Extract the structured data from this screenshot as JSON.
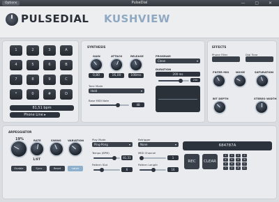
{
  "window": {
    "title": "PulseDial",
    "options_label": "Options",
    "controls": "—  ▢  ✕"
  },
  "brand": {
    "name": "PULSEDIAL",
    "vendor": "KUSHVIEW"
  },
  "keypad": {
    "keys": [
      "1",
      "2",
      "3",
      "A",
      "4",
      "5",
      "6",
      "B",
      "7",
      "8",
      "9",
      "C",
      "*",
      "0",
      "#",
      "D"
    ],
    "bpm": "81,51 bpm",
    "line": "Phone Line",
    "line_chevron": "▸"
  },
  "synthesis": {
    "title": "SYNTHESIS",
    "gain": {
      "label": "GAIN",
      "value": "0,80"
    },
    "attack": {
      "label": "ATTACK",
      "value": "16,00"
    },
    "release": {
      "label": "RELEASE",
      "value": "108ms"
    },
    "program": {
      "label": "PROGRAM",
      "value": "Clean"
    },
    "duration": {
      "label": "DURATION",
      "value": "200 ms",
      "max": "250"
    },
    "tone_mode": {
      "label": "Tone Mode",
      "value": "Hold"
    },
    "base_midi": {
      "label": "Base MIDI Note",
      "value": "48"
    }
  },
  "effects": {
    "title": "EFFECTS",
    "phone_filter": "Phone Filter",
    "dial_tone": "Dial Tone",
    "knobs": [
      {
        "label": "FILTER MIX"
      },
      {
        "label": "NOISE"
      },
      {
        "label": "SATURATION"
      },
      {
        "label": "BIT DEPTH"
      },
      {
        "label": "STEREO WIDTH"
      }
    ]
  },
  "arpeggiator": {
    "title": "ARPEGGIATOR",
    "knobs": [
      {
        "label": "",
        "value": "19%"
      },
      {
        "label": "RATE",
        "value": "1/8T"
      },
      {
        "label": "SWING",
        "value": ""
      },
      {
        "label": "VARIATION",
        "value": ""
      }
    ],
    "buttons": [
      "Enable",
      "Sync",
      "Reset",
      "Latch"
    ],
    "play_mode": {
      "label": "Play Mode",
      "value": "Ping-Pong"
    },
    "retrigger": {
      "label": "Retrigger",
      "value": "None"
    },
    "tempo": {
      "label": "Tempo (BPM)",
      "value": "81,51"
    },
    "midi_channel": {
      "label": "MIDI Channel",
      "value": "1"
    },
    "pattern_slot": {
      "label": "Pattern Slot",
      "value": "6"
    },
    "pattern_length": {
      "label": "Pattern Length",
      "value": "16"
    }
  },
  "recorder": {
    "display": "684787A",
    "rec_label": "REC",
    "clear_label": "CLEAR",
    "mini_keys": [
      "1",
      "2",
      "3",
      "A",
      "4",
      "5",
      "6",
      "B",
      "7",
      "8",
      "9",
      "C",
      "*",
      "0",
      "#",
      "D"
    ]
  },
  "colors": {
    "accent": "#8fa9c3",
    "dark": "#2d333c",
    "panel": "#e9ebee"
  }
}
